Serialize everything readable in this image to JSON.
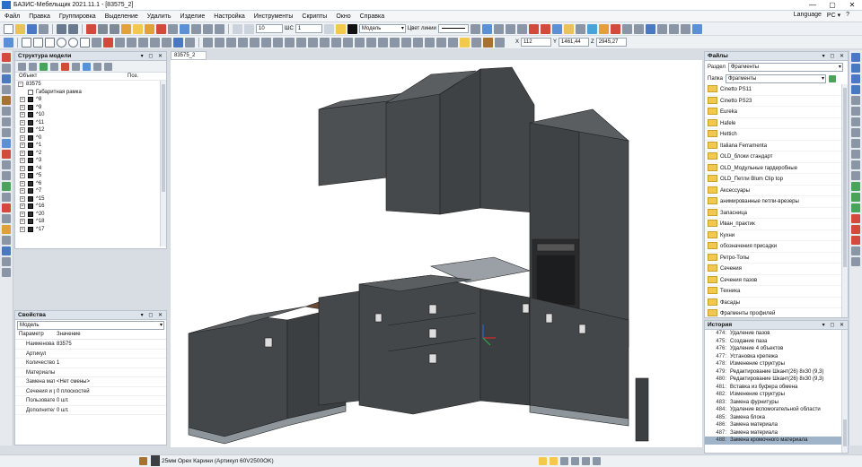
{
  "window": {
    "title": "БАЗИС-Мебельщик 2021.11.1 - [83575_2]",
    "minimize": "—",
    "maximize": "▢",
    "close": "✕"
  },
  "menu": [
    "Файл",
    "Правка",
    "Группировка",
    "Выделение",
    "Удалить",
    "Изделие",
    "Настройка",
    "Инструменты",
    "Скрипты",
    "Окно",
    "Справка"
  ],
  "menu_right": {
    "language": "Language",
    "pc": "PC ▾",
    "help": "?"
  },
  "toolbar": {
    "line_width": "10",
    "shc_label": "ШС",
    "shc_value": "1",
    "layer": "Модель",
    "line_color_label": "Цвет линии",
    "x_label": "X",
    "x_value": "112",
    "y_label": "Y",
    "y_value": "1461,44",
    "z_label": "Z",
    "z_value": "2945,27"
  },
  "model_tree": {
    "title": "Структура модели",
    "col_object": "Объект",
    "col_pos": "Поз.",
    "root": "83575",
    "frame": "Габаритная рамка",
    "items": [
      "^8",
      "^9",
      "^10",
      "^11",
      "^12",
      "^0",
      "^1",
      "^2",
      "^3",
      "^4",
      "^5",
      "^6",
      "^7",
      "^15",
      "^16",
      "^20",
      "^18",
      "^17"
    ]
  },
  "properties": {
    "title": "Свойства",
    "filter": "Модель",
    "col_param": "Параметр",
    "col_value": "Значение",
    "rows": [
      {
        "k": "Наименован",
        "v": "83575"
      },
      {
        "k": "Артикул",
        "v": ""
      },
      {
        "k": "Количество",
        "v": "1"
      },
      {
        "k": "Материалы",
        "v": ""
      },
      {
        "k": "Замена мат",
        "v": "<Нет смены>"
      },
      {
        "k": "Сечения и р",
        "v": "0 плоскостей"
      },
      {
        "k": "Пользовате",
        "v": "0 шт."
      },
      {
        "k": "Дополнител",
        "v": "0 шт."
      }
    ]
  },
  "viewport_tab": "83575_2",
  "files": {
    "title": "Файлы",
    "section_label": "Раздел",
    "section_value": "Фрагменты",
    "folder_label": "Папка",
    "folder_value": "Фрагменты",
    "items": [
      "Cinetto PS11",
      "Cinetto PS23",
      "Eureka",
      "Hafele",
      "Hettich",
      "Italiana Ferramenta",
      "OLD_блоки стандарт",
      "OLD_Модульные гардеробные",
      "OLD_Петли Blum Clip top",
      "Аксессуары",
      "анимированные петли-врезеры",
      "Запасница",
      "Иван_практик",
      "Кухни",
      "обозначения присадки",
      "Ретро-Топы",
      "Сечения",
      "Сечения пазов",
      "Техника",
      "Фасады",
      "Фрагменты профилей"
    ]
  },
  "history": {
    "title": "История",
    "items": [
      {
        "n": "474:",
        "t": "Удаление пазов"
      },
      {
        "n": "475:",
        "t": "Создание паза"
      },
      {
        "n": "476:",
        "t": "Удаление 4 объектов"
      },
      {
        "n": "477:",
        "t": "Установка крепежа"
      },
      {
        "n": "478:",
        "t": "Изменение структуры"
      },
      {
        "n": "479:",
        "t": "Редактирование Шкант(26) 8x30 (9,3)"
      },
      {
        "n": "480:",
        "t": "Редактирование Шкант(26) 8x30 (9,3)"
      },
      {
        "n": "481:",
        "t": "Вставка из буфера обмена"
      },
      {
        "n": "482:",
        "t": "Изменение структуры"
      },
      {
        "n": "483:",
        "t": "Замена фурнитуры"
      },
      {
        "n": "484:",
        "t": "Удаление вспомогательной области"
      },
      {
        "n": "485:",
        "t": "Замена блока"
      },
      {
        "n": "486:",
        "t": "Замена материала"
      },
      {
        "n": "487:",
        "t": "Замена материала"
      },
      {
        "n": "488:",
        "t": "Замена кромочного материала"
      }
    ],
    "selected_index": 14
  },
  "status": {
    "material": "25мм Орех Карини (Артикул 60V2500OK)"
  },
  "colors": {
    "accent_folder": "#f2c94c",
    "selection": "#9fb4c9",
    "carcass": "#3f4244"
  }
}
